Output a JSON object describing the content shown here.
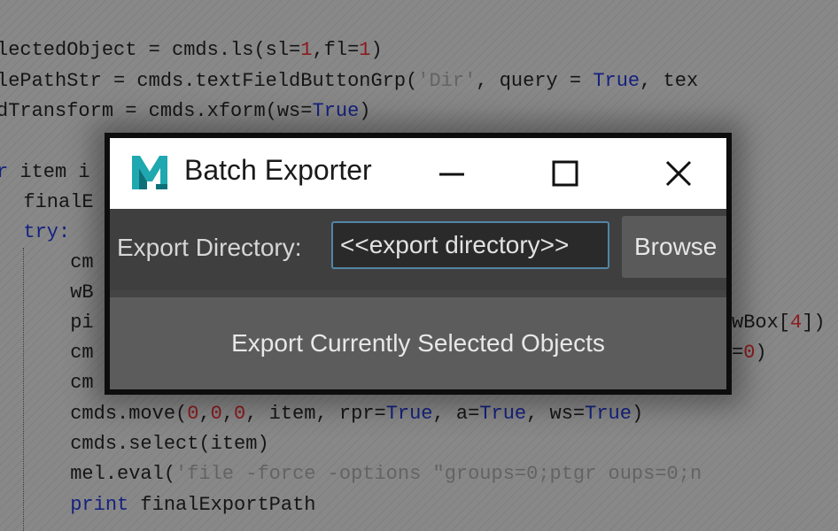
{
  "window": {
    "title": "Batch Exporter",
    "icon": "maya-logo-icon",
    "controls": [
      "minimize-icon",
      "maximize-icon",
      "close-icon"
    ]
  },
  "export_row": {
    "label": "Export Directory:",
    "input_value": "<<export directory>>",
    "browse_label": "Browse"
  },
  "export_button_label": "Export Currently Selected Objects",
  "colors": {
    "accent_focus": "#5285a6",
    "panel": "#444444",
    "button": "#5c5c5c",
    "titlebar": "#ffffff"
  },
  "code": {
    "l1_a": "lectedObject = cmds.ls(sl=",
    "l1_n1": "1",
    "l1_b": ",fl=",
    "l1_n2": "1",
    "l1_c": ")",
    "l2_a": "lePathStr = cmds.textFieldButtonGrp(",
    "l2_s": "'Dir'",
    "l2_b": ", query = ",
    "l2_k": "True",
    "l2_c": ", tex",
    "l3_a": "dTransform = cmds.xform(ws=",
    "l3_k": "True",
    "l3_b": ")",
    "l4_k": "r",
    "l4_a": " item i",
    "l5_a": "  finalE",
    "l6_k": "  try:",
    "l7_a": "      cm",
    "l8_a": "      wB",
    "l9_a": "      pi",
    "l9_b": "wBox[",
    "l9_n": "4",
    "l9_c": "])",
    "l10_a": "      cm",
    "l10_b": "=",
    "l10_n": "0",
    "l10_c": ")",
    "l11_a": "      cm",
    "l12_a": "      cmds.move(",
    "l12_n1": "0",
    "l12_b": ",",
    "l12_n2": "0",
    "l12_c": ",",
    "l12_n3": "0",
    "l12_d": ", item, rpr=",
    "l12_k1": "True",
    "l12_e": ", a=",
    "l12_k2": "True",
    "l12_f": ", ws=",
    "l12_k3": "True",
    "l12_g": ")",
    "l13_a": "      cmds.select(item)",
    "l14_a": "      mel.eval(",
    "l14_s": "'file -force -options \"groups=0;ptgr oups=0;n",
    "l15_k": "      print",
    "l15_a": " finalExportPath"
  }
}
